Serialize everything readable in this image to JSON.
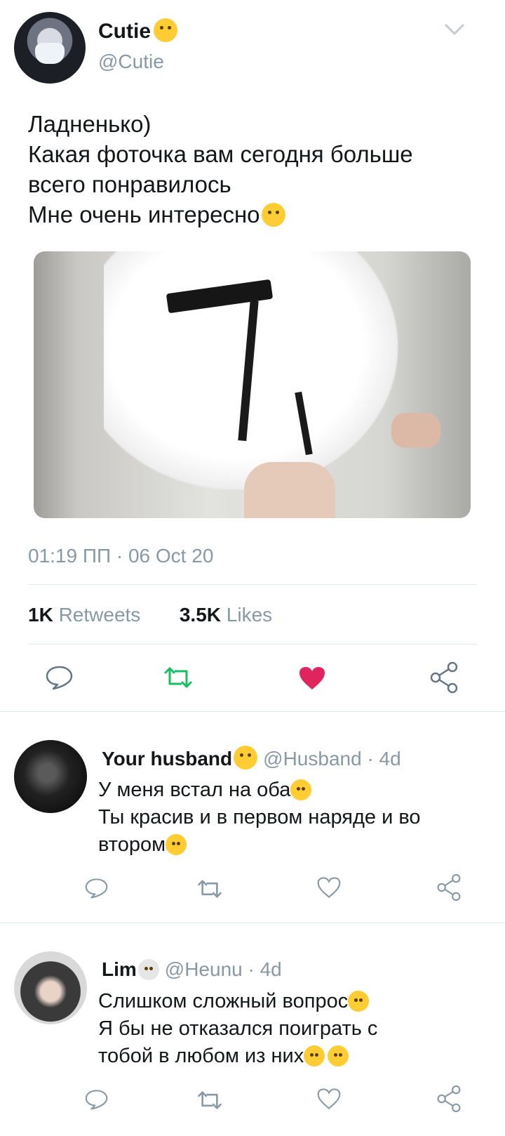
{
  "tweet": {
    "name": "Cutie",
    "handle": "@Cutie",
    "lines": [
      "Ладненько)",
      "Какая фоточка вам сегодня больше",
      "всего понравилось",
      "Мне очень интересно"
    ],
    "timestamp": "01:19 ПП · 06 Oct 20",
    "retweets_count": "1K",
    "retweets_label": "Retweets",
    "likes_count": "3.5K",
    "likes_label": "Likes"
  },
  "replies": [
    {
      "name": "Your husband",
      "handle": "@Husband · 4d",
      "lines": [
        "У меня встал на оба",
        "Ты красив и в первом наряде и во",
        "втором"
      ]
    },
    {
      "name": "Lim",
      "handle": "@Heunu · 4d",
      "lines": [
        "Слишком сложный вопрос",
        "Я бы не отказался поиграть с",
        "тобой в любом из них"
      ]
    }
  ],
  "colors": {
    "retweet_active": "#17bf63",
    "like_active": "#e0245e",
    "icon_gray": "#8899a6",
    "divider": "#e1e8ed"
  },
  "icons": [
    "chevron-down-icon",
    "reply-icon",
    "retweet-icon",
    "like-icon",
    "share-icon"
  ]
}
